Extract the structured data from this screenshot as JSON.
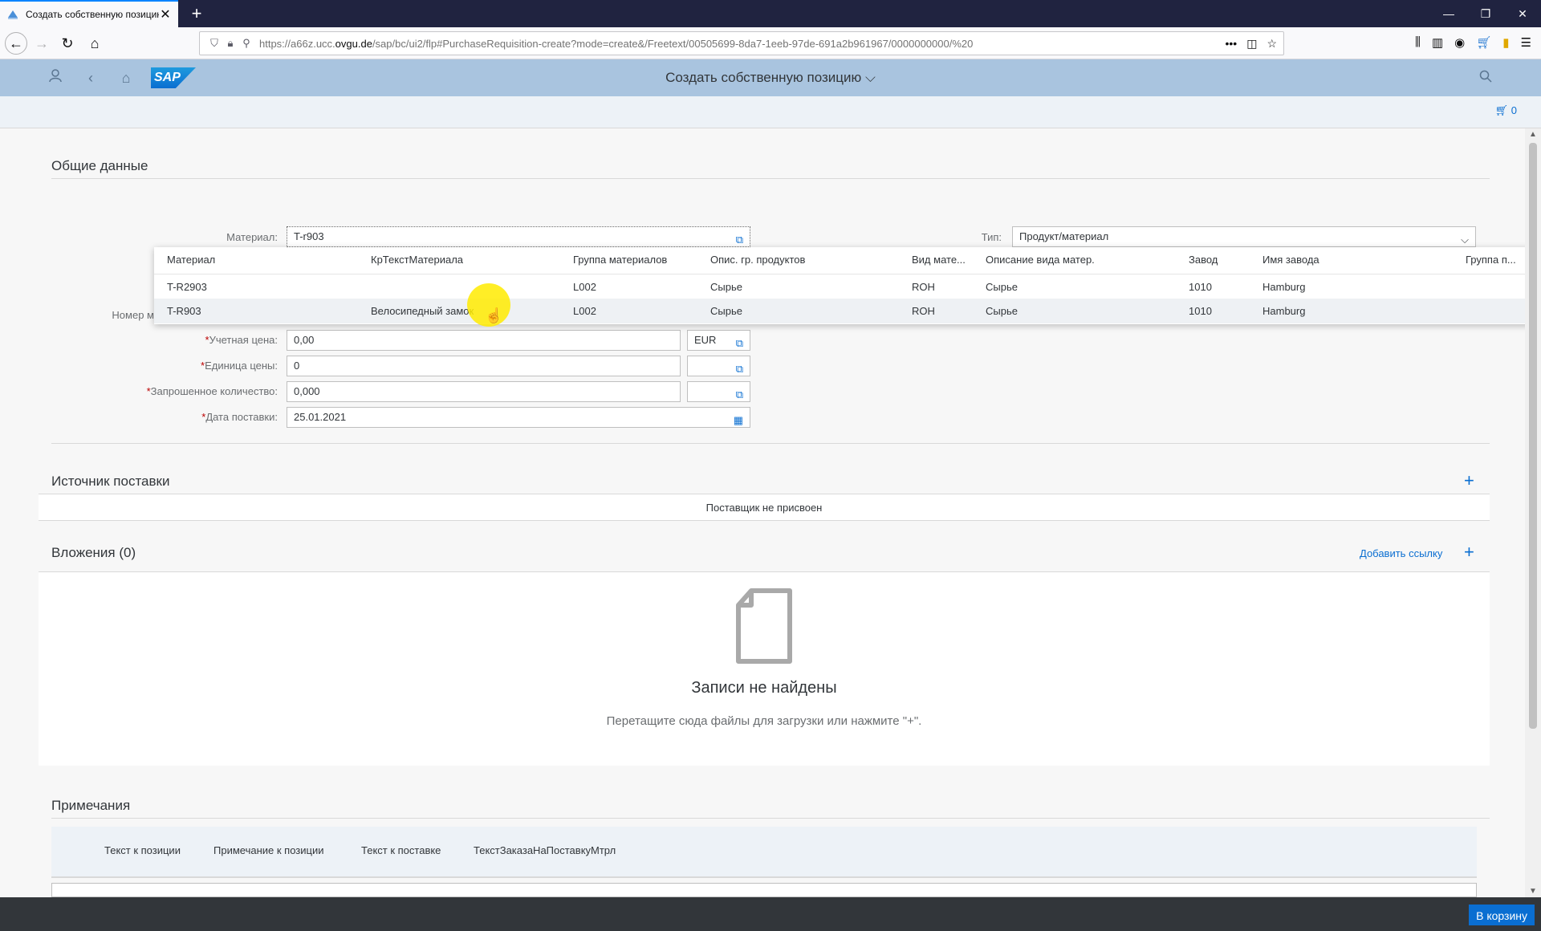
{
  "browser": {
    "tab_title": "Создать собственную позицию",
    "url_prefix": "https://a66z.ucc.",
    "url_domain": "ovgu.de",
    "url_rest": "/sap/bc/ui2/flp#PurchaseRequisition-create?mode=create&/Freetext/00505699-8da7-1eeb-97de-691a2b961967/0000000000/%20"
  },
  "shell": {
    "title": "Создать собственную позицию",
    "logo": "SAP",
    "cart_count": "0"
  },
  "general": {
    "title": "Общие данные",
    "material_label": "Материал:",
    "material_value": "T-r903",
    "type_label": "Тип:",
    "type_value": "Продукт/материал",
    "number_label_partial": "Номер м",
    "price_label": "Учетная цена:",
    "price_value": "0,00",
    "currency_value": "EUR",
    "price_unit_label": "Единица цены:",
    "price_unit_value": "0",
    "quantity_label": "Запрошенное количество:",
    "quantity_value": "0,000",
    "delivery_label": "Дата поставки:",
    "delivery_value": "25.01.2021",
    "required_mark": "*"
  },
  "suggestions": {
    "headers": [
      "Материал",
      "КрТекстМатериала",
      "Группа материалов",
      "Опис. гр. продуктов",
      "Вид мате...",
      "Описание вида матер.",
      "Завод",
      "Имя завода",
      "Группа п..."
    ],
    "rows": [
      [
        "T-R2903",
        "",
        "L002",
        "Сырье",
        "ROH",
        "Сырье",
        "1010",
        "Hamburg",
        ""
      ],
      [
        "T-R903",
        "Велосипедный замок",
        "L002",
        "Сырье",
        "ROH",
        "Сырье",
        "1010",
        "Hamburg",
        ""
      ]
    ]
  },
  "source": {
    "title": "Источник поставки",
    "empty_text": "Поставщик не присвоен"
  },
  "attachments": {
    "title": "Вложения (0)",
    "add_link": "Добавить ссылку",
    "empty_title": "Записи не найдены",
    "empty_hint": "Перетащите сюда файлы для загрузки или нажмите \"+\"."
  },
  "notes": {
    "title": "Примечания",
    "tabs": [
      "Текст к позиции",
      "Примечание к позиции",
      "Текст к поставке",
      "ТекстЗаказаНаПоставкуМтрл"
    ]
  },
  "footer": {
    "cart_button": "В корзину"
  }
}
